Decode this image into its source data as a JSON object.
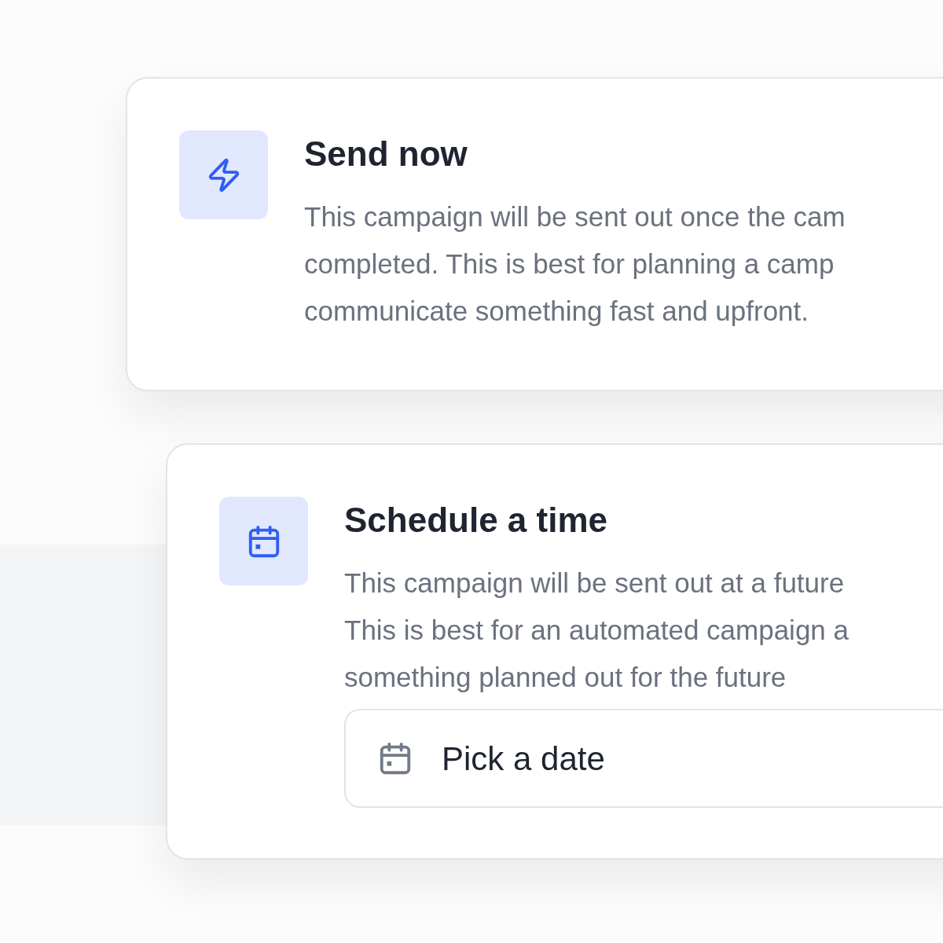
{
  "cards": [
    {
      "kind": "lightning",
      "title": "Send now",
      "description_lines": [
        "This campaign will be sent out once the cam",
        "completed. This is best for planning a camp",
        "communicate something fast and upfront."
      ]
    },
    {
      "kind": "calendar",
      "title": "Schedule a time",
      "description_lines": [
        "This campaign will be sent out at a future",
        "This is best for an automated campaign a",
        "something planned out for the future"
      ],
      "date_field": {
        "placeholder": "Pick a date"
      }
    }
  ]
}
